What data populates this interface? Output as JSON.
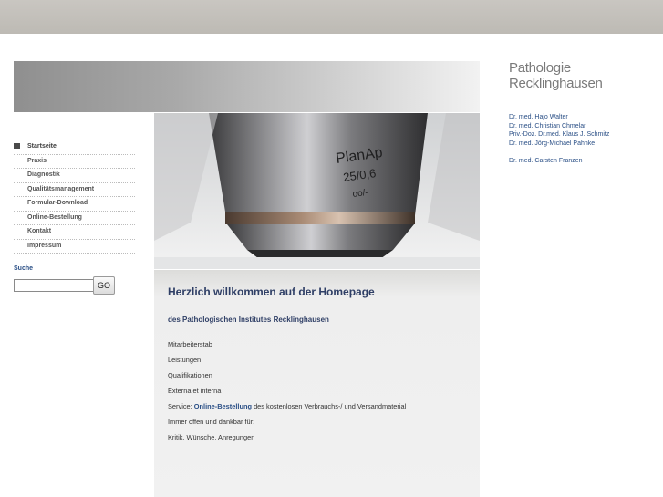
{
  "brand": {
    "line1": "Pathologie",
    "line2": "Recklinghausen"
  },
  "doctors": [
    "Dr. med. Hajo Walter",
    "Dr. med. Christian Chmelar",
    "Priv.-Doz. Dr.med. Klaus J. Schmitz",
    "Dr. med. Jörg-Michael Pahnke",
    "Dr. med. Carsten Franzen"
  ],
  "nav": {
    "items": [
      {
        "label": "Startseite",
        "active": true
      },
      {
        "label": "Praxis"
      },
      {
        "label": "Diagnostik"
      },
      {
        "label": "Qualitätsmanagement"
      },
      {
        "label": "Formular-Download"
      },
      {
        "label": "Online-Bestellung"
      },
      {
        "label": "Kontakt"
      },
      {
        "label": "Impressum"
      }
    ]
  },
  "search": {
    "label": "Suche",
    "value": "",
    "button": "GO"
  },
  "hero": {
    "objective_text1": "PlanAp",
    "objective_text2": "25/0,6",
    "objective_text3": "oo/-"
  },
  "main": {
    "title": "Herzlich willkommen auf der Homepage",
    "subtitle": "des Pathologischen Institutes Recklinghausen",
    "lines": {
      "l1": "Mitarbeiterstab",
      "l2": "Leistungen",
      "l3": "Qualifikationen",
      "l4": "Externa et interna",
      "service_prefix": "Service: ",
      "service_link": "Online-Bestellung",
      "service_suffix": " des kostenlosen Verbrauchs-/ und Versandmaterial",
      "l6": "Immer offen und dankbar für:",
      "l7": "Kritik, Wünsche, Anregungen"
    }
  }
}
